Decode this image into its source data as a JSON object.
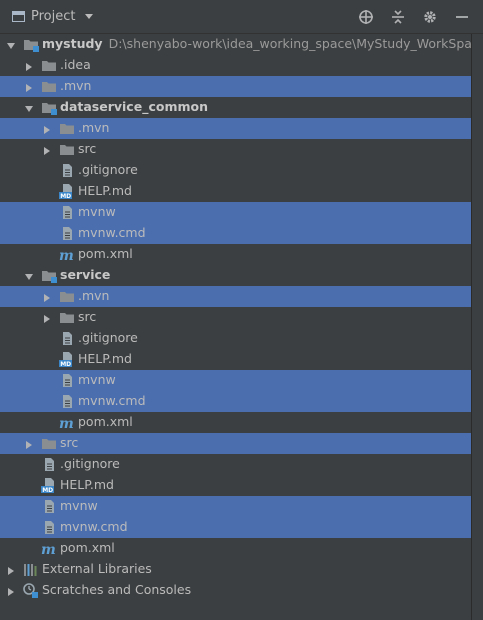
{
  "toolbar": {
    "title": "Project",
    "icons": [
      "project-view-icon",
      "dropdown-caret-icon",
      "locate-icon",
      "collapse-all-icon",
      "settings-icon",
      "hide-icon"
    ]
  },
  "colors": {
    "background": "#3c3f41",
    "selection": "#4b6eaf",
    "folder": "#8a8e91",
    "module_marker": "#3d8fd1",
    "text": "#bbbbbb"
  },
  "tree": [
    {
      "label": "mystudy",
      "path": "D:\\shenyabo-work\\idea_working_space\\MyStudy_WorkSpace\\m",
      "depth": 0,
      "expander": "open",
      "icon": "module",
      "bold": true,
      "selected": false
    },
    {
      "label": ".idea",
      "depth": 1,
      "expander": "closed",
      "icon": "folder",
      "selected": false
    },
    {
      "label": ".mvn",
      "depth": 1,
      "expander": "closed",
      "icon": "folder",
      "selected": true
    },
    {
      "label": "dataservice_common",
      "depth": 1,
      "expander": "open",
      "icon": "module",
      "bold": true,
      "selected": false
    },
    {
      "label": ".mvn",
      "depth": 2,
      "expander": "closed",
      "icon": "folder",
      "selected": true
    },
    {
      "label": "src",
      "depth": 2,
      "expander": "closed",
      "icon": "folder",
      "selected": false
    },
    {
      "label": ".gitignore",
      "depth": 2,
      "icon": "text-file",
      "selected": false
    },
    {
      "label": "HELP.md",
      "depth": 2,
      "icon": "md-file",
      "selected": false
    },
    {
      "label": "mvnw",
      "depth": 2,
      "icon": "text-file",
      "selected": true
    },
    {
      "label": "mvnw.cmd",
      "depth": 2,
      "icon": "text-file",
      "selected": true
    },
    {
      "label": "pom.xml",
      "depth": 2,
      "icon": "maven-file",
      "selected": false
    },
    {
      "label": "service",
      "depth": 1,
      "expander": "open",
      "icon": "module",
      "bold": true,
      "selected": false
    },
    {
      "label": ".mvn",
      "depth": 2,
      "expander": "closed",
      "icon": "folder",
      "selected": true
    },
    {
      "label": "src",
      "depth": 2,
      "expander": "closed",
      "icon": "folder",
      "selected": false
    },
    {
      "label": ".gitignore",
      "depth": 2,
      "icon": "text-file",
      "selected": false
    },
    {
      "label": "HELP.md",
      "depth": 2,
      "icon": "md-file",
      "selected": false
    },
    {
      "label": "mvnw",
      "depth": 2,
      "icon": "text-file",
      "selected": true
    },
    {
      "label": "mvnw.cmd",
      "depth": 2,
      "icon": "text-file",
      "selected": true
    },
    {
      "label": "pom.xml",
      "depth": 2,
      "icon": "maven-file",
      "selected": false
    },
    {
      "label": "src",
      "depth": 1,
      "expander": "closed",
      "icon": "folder",
      "selected": true
    },
    {
      "label": ".gitignore",
      "depth": 1,
      "icon": "text-file",
      "selected": false
    },
    {
      "label": "HELP.md",
      "depth": 1,
      "icon": "md-file",
      "selected": false
    },
    {
      "label": "mvnw",
      "depth": 1,
      "icon": "text-file",
      "selected": true
    },
    {
      "label": "mvnw.cmd",
      "depth": 1,
      "icon": "text-file",
      "selected": true
    },
    {
      "label": "pom.xml",
      "depth": 1,
      "icon": "maven-file",
      "selected": false
    },
    {
      "label": "External Libraries",
      "depth": 0,
      "expander": "closed",
      "icon": "libraries",
      "selected": false
    },
    {
      "label": "Scratches and Consoles",
      "depth": 0,
      "expander": "closed",
      "icon": "scratches",
      "selected": false
    }
  ]
}
